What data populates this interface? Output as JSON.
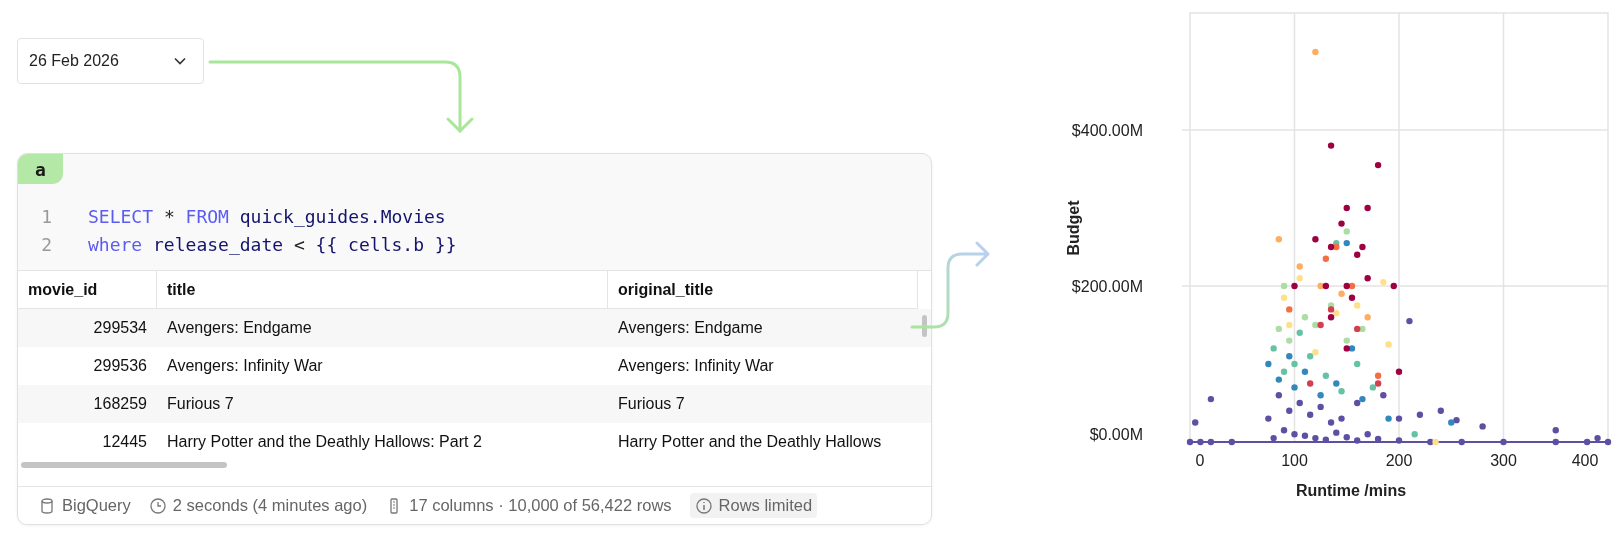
{
  "date_dropdown": {
    "value": "26 Feb 2026"
  },
  "cell": {
    "tab": "a",
    "code_lines": [
      {
        "number": "1",
        "tokens": [
          {
            "text": "SELECT",
            "kind": "keyword"
          },
          {
            "text": "*",
            "kind": "operator"
          },
          {
            "text": "FROM",
            "kind": "keyword"
          },
          {
            "text": "quick_guides.Movies",
            "kind": "identifier"
          }
        ]
      },
      {
        "number": "2",
        "tokens": [
          {
            "text": "where",
            "kind": "keyword"
          },
          {
            "text": "release_date",
            "kind": "identifier"
          },
          {
            "text": "<",
            "kind": "operator"
          },
          {
            "text": "{{ cells.b }}",
            "kind": "template"
          }
        ]
      }
    ],
    "table": {
      "columns": [
        "movie_id",
        "title",
        "original_title"
      ],
      "rows": [
        [
          "299534",
          "Avengers: Endgame",
          "Avengers: Endgame"
        ],
        [
          "299536",
          "Avengers: Infinity War",
          "Avengers: Infinity War"
        ],
        [
          "168259",
          "Furious 7",
          "Furious 7"
        ],
        [
          "12445",
          "Harry Potter and the Deathly Hallows: Part 2",
          "Harry Potter and the Deathly Hallows"
        ]
      ]
    },
    "status_bar": [
      {
        "kind": "database",
        "text": "BigQuery"
      },
      {
        "kind": "time",
        "text": "2 seconds (4 minutes ago)"
      },
      {
        "kind": "columns",
        "text": "17 columns · 10,000 of 56,422 rows"
      },
      {
        "kind": "info",
        "text": "Rows limited"
      }
    ]
  },
  "chart": {
    "chart_data": {
      "type": "scatter",
      "xlabel": "Runtime /mins",
      "ylabel": "Budget",
      "grid": true,
      "xlim": [
        0,
        400
      ],
      "ylim": [
        0,
        550
      ],
      "xticks": [
        0,
        100,
        200,
        300,
        400
      ],
      "yticks": [
        {
          "value": 0,
          "label": "$0.00M"
        },
        {
          "value": 200,
          "label": "$200.00M"
        },
        {
          "value": 400,
          "label": "$400.00M"
        }
      ],
      "series": [
        {
          "color": "#5e4fa2",
          "x": [
            0,
            10,
            20,
            40,
            80,
            90,
            100,
            110,
            120,
            130,
            140,
            150,
            160,
            170,
            180,
            200,
            230,
            260,
            300,
            350,
            380,
            400,
            5,
            20,
            280,
            350,
            390,
            210,
            240,
            255,
            75,
            85,
            95,
            105,
            115,
            125,
            135,
            145,
            160,
            185,
            200,
            220
          ],
          "values": [
            0,
            0,
            0,
            0,
            5,
            15,
            10,
            8,
            5,
            3,
            12,
            6,
            2,
            10,
            4,
            2,
            0,
            0,
            0,
            0,
            0,
            0,
            25,
            55,
            20,
            15,
            5,
            155,
            40,
            28,
            30,
            60,
            40,
            50,
            35,
            45,
            25,
            30,
            50,
            60,
            30,
            35
          ]
        },
        {
          "color": "#3288bd",
          "x": [
            75,
            85,
            100,
            110,
            125,
            140,
            155,
            165,
            190,
            250,
            150,
            95
          ],
          "values": [
            100,
            80,
            70,
            90,
            60,
            75,
            120,
            55,
            30,
            25,
            255,
            110
          ]
        },
        {
          "color": "#66c2a5",
          "x": [
            80,
            90,
            100,
            115,
            130,
            145,
            160,
            175,
            215,
            105,
            140
          ],
          "values": [
            120,
            90,
            100,
            110,
            85,
            65,
            100,
            70,
            10,
            140,
            255
          ]
        },
        {
          "color": "#abdda4",
          "x": [
            85,
            95,
            110,
            120,
            135,
            150,
            165,
            150,
            90
          ],
          "values": [
            145,
            130,
            160,
            150,
            175,
            130,
            145,
            270,
            200
          ]
        },
        {
          "color": "#fee08b",
          "x": [
            90,
            105,
            120,
            140,
            160,
            185,
            190,
            95,
            235
          ],
          "values": [
            185,
            210,
            115,
            165,
            175,
            205,
            125,
            150,
            0
          ]
        },
        {
          "color": "#fdae61",
          "x": [
            85,
            105,
            125,
            145,
            170,
            120
          ],
          "values": [
            260,
            225,
            200,
            190,
            160,
            500
          ]
        },
        {
          "color": "#f46d43",
          "x": [
            95,
            130,
            155,
            180,
            140
          ],
          "values": [
            170,
            235,
            200,
            85,
            250
          ]
        },
        {
          "color": "#d53e4f",
          "x": [
            115,
            135,
            160,
            180,
            125
          ],
          "values": [
            75,
            170,
            145,
            75,
            150
          ]
        },
        {
          "color": "#9e0142",
          "x": [
            135,
            180,
            150,
            170,
            145,
            120,
            135,
            165,
            160,
            170,
            195,
            200,
            100,
            130,
            150,
            155,
            135,
            150
          ],
          "values": [
            380,
            355,
            300,
            300,
            280,
            260,
            250,
            250,
            240,
            210,
            200,
            90,
            200,
            200,
            200,
            185,
            160,
            120
          ]
        }
      ]
    }
  }
}
